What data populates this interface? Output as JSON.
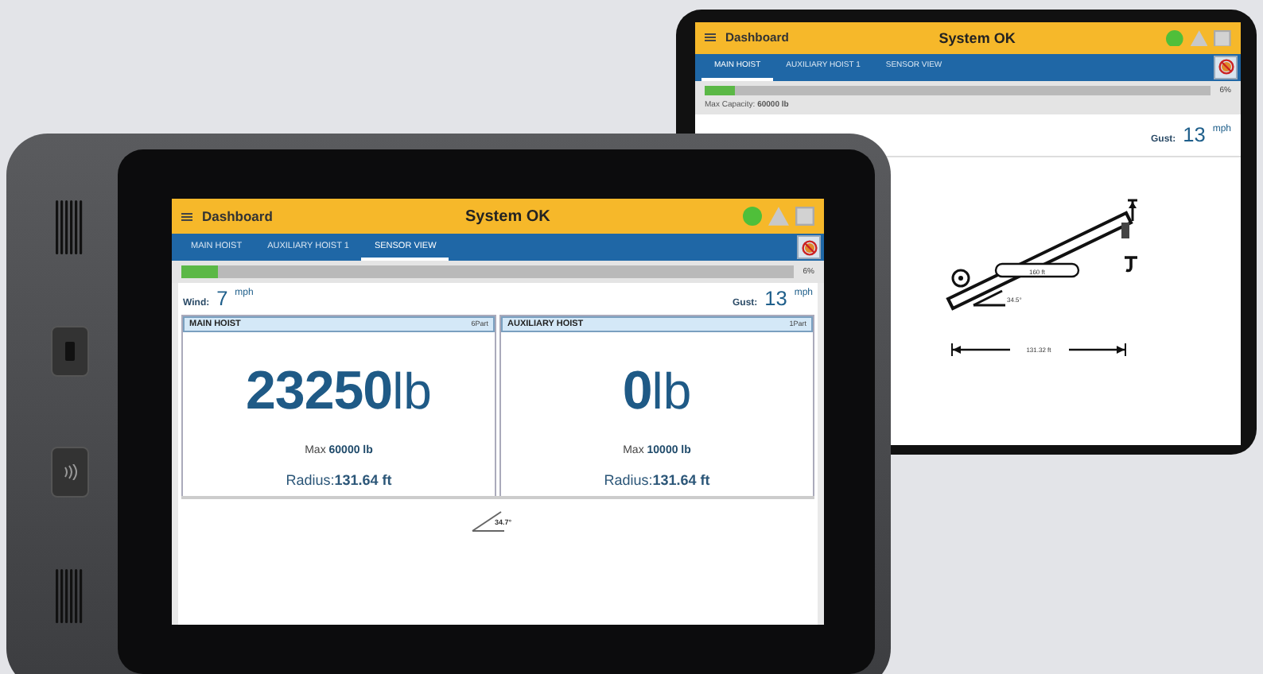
{
  "back_tablet": {
    "header": {
      "title": "Dashboard",
      "status": "System OK"
    },
    "tabs": [
      {
        "label": "MAIN HOIST",
        "selected": true
      },
      {
        "label": "AUXILIARY HOIST 1",
        "selected": false
      },
      {
        "label": "SENSOR VIEW",
        "selected": false
      }
    ],
    "progress": {
      "level": 0.06,
      "reading": "6%"
    },
    "max_capacity": {
      "label": "Max Capacity:",
      "value": "60000 lb"
    },
    "gust": {
      "label": "Gust:",
      "value": "13",
      "unit": "mph"
    },
    "diagram": {
      "boom_length": "160 ft",
      "angle": "34.5°",
      "radius": "131.32 ft"
    }
  },
  "front_tablet": {
    "header": {
      "title": "Dashboard",
      "status": "System OK"
    },
    "tabs": [
      {
        "label": "MAIN HOIST",
        "selected": false
      },
      {
        "label": "AUXILIARY HOIST 1",
        "selected": false
      },
      {
        "label": "SENSOR VIEW",
        "selected": true
      }
    ],
    "progress": {
      "level": 0.06,
      "reading": "6%"
    },
    "wind": {
      "label": "Wind:",
      "value": "7",
      "unit": "mph"
    },
    "gust": {
      "label": "Gust:",
      "value": "13",
      "unit": "mph"
    },
    "hoists": [
      {
        "title": "MAIN HOIST",
        "parts": "6Part",
        "load": "23250",
        "unit": "lb",
        "max_label": "Max",
        "max_value": "60000 lb",
        "radius_label": "Radius:",
        "radius_value": "131.64 ft"
      },
      {
        "title": "AUXILIARY HOIST",
        "parts": "1Part",
        "load": "0",
        "unit": "lb",
        "max_label": "Max",
        "max_value": "10000 lb",
        "radius_label": "Radius:",
        "radius_value": "131.64 ft"
      }
    ],
    "angle": "34.7°"
  }
}
